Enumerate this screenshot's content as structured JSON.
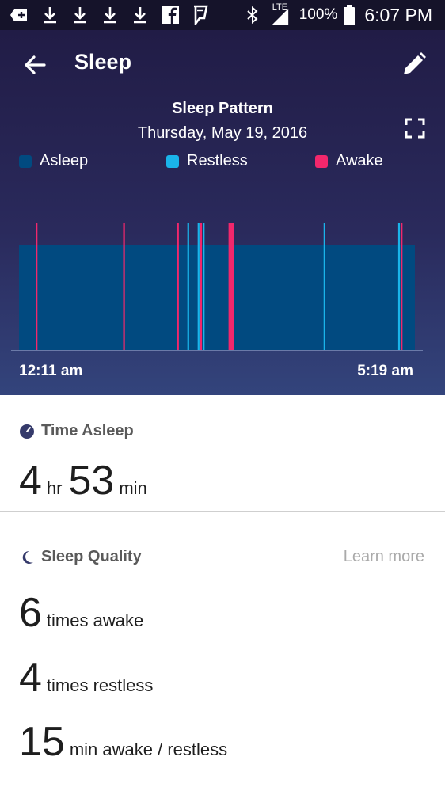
{
  "status_bar": {
    "network": "LTE",
    "battery": "100%",
    "time": "6:07 PM"
  },
  "header": {
    "title": "Sleep",
    "back_icon": "arrow-left-icon",
    "edit_icon": "pencil-icon"
  },
  "chart_data": {
    "type": "timeline",
    "title": "Sleep Pattern",
    "subtitle": "Thursday, May 19, 2016",
    "start_label": "12:11 am",
    "end_label": "5:19 am",
    "start_min": 0,
    "end_min": 308,
    "legend": [
      {
        "name": "Asleep",
        "color": "#014a80"
      },
      {
        "name": "Restless",
        "color": "#1ab4ea"
      },
      {
        "name": "Awake",
        "color": "#f2276c"
      }
    ],
    "events": [
      {
        "state": "Awake",
        "start": 13,
        "duration": 1
      },
      {
        "state": "Awake",
        "start": 81,
        "duration": 1
      },
      {
        "state": "Awake",
        "start": 123,
        "duration": 1
      },
      {
        "state": "Restless",
        "start": 131,
        "duration": 1
      },
      {
        "state": "Restless",
        "start": 139,
        "duration": 1
      },
      {
        "state": "Awake",
        "start": 141,
        "duration": 1
      },
      {
        "state": "Restless",
        "start": 143,
        "duration": 1
      },
      {
        "state": "Awake",
        "start": 163,
        "duration": 4
      },
      {
        "state": "Restless",
        "start": 237,
        "duration": 1
      },
      {
        "state": "Restless",
        "start": 295,
        "duration": 1
      },
      {
        "state": "Awake",
        "start": 297,
        "duration": 1
      }
    ]
  },
  "time_asleep": {
    "heading": "Time Asleep",
    "hours": "4",
    "hours_unit": "hr",
    "minutes": "53",
    "minutes_unit": "min"
  },
  "sleep_quality": {
    "heading": "Sleep Quality",
    "learn_more": "Learn more",
    "stats": [
      {
        "value": "6",
        "label": "times awake"
      },
      {
        "value": "4",
        "label": "times restless"
      },
      {
        "value": "15",
        "label": "min awake / restless"
      }
    ]
  },
  "colors": {
    "header_top": "#211c46",
    "header_bottom": "#33447c",
    "asleep": "#014a80",
    "restless": "#1ab4ea",
    "awake": "#f2276c"
  }
}
